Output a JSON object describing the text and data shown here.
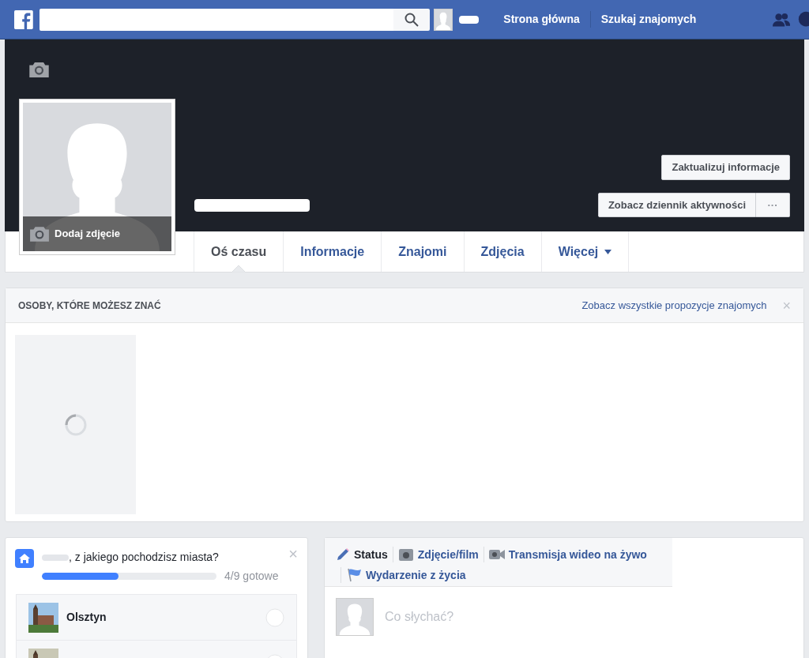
{
  "top_bar": {
    "nav": [
      "Strona główna",
      "Szukaj znajomych"
    ]
  },
  "profile": {
    "add_photo": "Dodaj zdjęcie",
    "buttons": [
      "Zaktualizuj informacje",
      "Zobacz dziennik aktywności"
    ],
    "more": "···"
  },
  "tabs": [
    {
      "label": "Oś czasu",
      "selected": true,
      "dropdown": false
    },
    {
      "label": "Informacje",
      "selected": false,
      "dropdown": false
    },
    {
      "label": "Znajomi",
      "selected": false,
      "dropdown": false
    },
    {
      "label": "Zdjęcia",
      "selected": false,
      "dropdown": false
    },
    {
      "label": "Więcej",
      "selected": false,
      "dropdown": true
    }
  ],
  "suggestions": {
    "title": "OSOBY, KTÓRE MOŻESZ ZNAĆ",
    "link": "Zobacz wszystkie propozycje znajomych",
    "close": "×",
    "loading": true
  },
  "city_prompt": {
    "question": ", z jakiego pochodzisz miasta?",
    "close": "×",
    "level": 0.44,
    "progress": "4/9 gotowe",
    "cities": [
      {
        "kind": "named",
        "name": "Olsztyn"
      },
      {
        "kind": "cut_off"
      }
    ]
  },
  "composer": {
    "actions": [
      {
        "label": "Status",
        "selected": true,
        "kind": "pencil"
      },
      {
        "label": "Zdjęcie/film",
        "selected": false,
        "kind": "camera"
      },
      {
        "label": "Transmisja wideo na żywo",
        "selected": false,
        "kind": "video"
      },
      {
        "label": "Wydarzenie z życia",
        "selected": false,
        "kind": "flag"
      }
    ],
    "placeholder": "Co słychać?"
  }
}
